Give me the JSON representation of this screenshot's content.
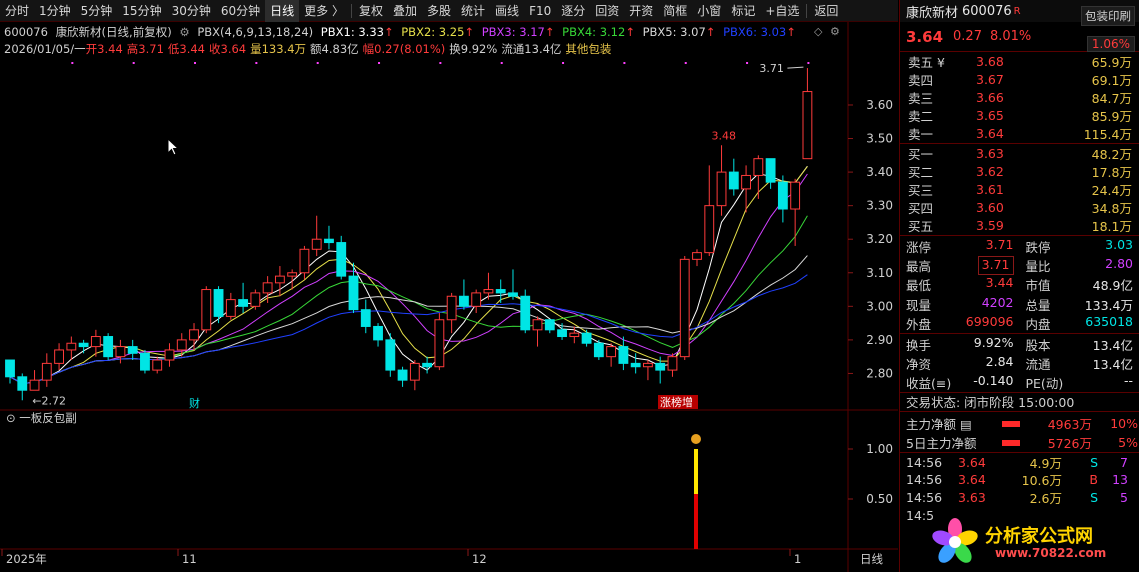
{
  "toolbar": {
    "items": [
      "分时",
      "1分钟",
      "5分钟",
      "15分钟",
      "30分钟",
      "60分钟",
      "日线",
      "更多 〉",
      "复权",
      "叠加",
      "多股",
      "统计",
      "画线",
      "F10",
      "逐分",
      "回资",
      "开资",
      "简框",
      "小窗",
      "标记",
      "+自选",
      "返回"
    ],
    "active_index": 6
  },
  "indicator_line": {
    "code": "600076",
    "name": "康欣新材(日线,前复权)",
    "formula": "PBX(4,6,9,13,18,24)",
    "pbx1": "PBX1: 3.33",
    "pbx2": "PBX2: 3.25",
    "pbx3": "PBX3: 3.17",
    "pbx4": "PBX4: 3.12",
    "pbx5": "PBX5: 3.07",
    "pbx6": "PBX6: 3.03"
  },
  "info_line": {
    "date": "2026/01/05/一",
    "open": "开3.44",
    "high": "高3.71",
    "low": "低3.44",
    "close": "收3.64",
    "volume": "量133.4万",
    "amount": "额4.83亿",
    "range": "幅0.27(8.01%)",
    "turnover": "换9.92%",
    "float": "流通13.4亿",
    "other": "其他包装"
  },
  "sub_indicator": {
    "title": "一板反包副"
  },
  "labels": {
    "high_label": "3.71",
    "peak_label": "3.48",
    "low_label": "2.72",
    "cai": "财",
    "zhangbang": "涨榜增"
  },
  "colors": {
    "up": "#ff3b3b",
    "down": "#00e5e5",
    "pbx1": "#ffffff",
    "pbx2": "#e6e04a",
    "pbx3": "#d040ff",
    "pbx4": "#38d838",
    "pbx5": "#d8d8d8",
    "pbx6": "#2040ff"
  },
  "chart_data": {
    "type": "candlestick",
    "price_axis": {
      "ticks": [
        "3.60",
        "3.50",
        "3.40",
        "3.30",
        "3.20",
        "3.10",
        "3.00",
        "2.90",
        "2.80"
      ],
      "min": 2.7,
      "max": 3.74
    },
    "sub_axis": {
      "ticks": [
        "1.00",
        "0.50"
      ]
    },
    "x_axis": {
      "labels": [
        "2025年",
        "11",
        "12",
        "1"
      ],
      "right_label": "日线"
    },
    "candles": [
      [
        2.84,
        2.84,
        2.77,
        2.79
      ],
      [
        2.79,
        2.8,
        2.72,
        2.75
      ],
      [
        2.75,
        2.81,
        2.75,
        2.78
      ],
      [
        2.78,
        2.86,
        2.76,
        2.83
      ],
      [
        2.83,
        2.89,
        2.81,
        2.87
      ],
      [
        2.87,
        2.91,
        2.84,
        2.89
      ],
      [
        2.89,
        2.9,
        2.86,
        2.88
      ],
      [
        2.88,
        2.93,
        2.85,
        2.91
      ],
      [
        2.91,
        2.92,
        2.84,
        2.85
      ],
      [
        2.85,
        2.9,
        2.83,
        2.88
      ],
      [
        2.88,
        2.9,
        2.84,
        2.86
      ],
      [
        2.86,
        2.87,
        2.8,
        2.81
      ],
      [
        2.81,
        2.85,
        2.8,
        2.84
      ],
      [
        2.84,
        2.89,
        2.82,
        2.87
      ],
      [
        2.87,
        2.92,
        2.85,
        2.9
      ],
      [
        2.9,
        2.95,
        2.87,
        2.93
      ],
      [
        2.93,
        3.06,
        2.92,
        3.05
      ],
      [
        3.05,
        3.06,
        2.95,
        2.97
      ],
      [
        2.97,
        3.04,
        2.96,
        3.02
      ],
      [
        3.02,
        3.07,
        2.98,
        3.0
      ],
      [
        3.0,
        3.05,
        2.99,
        3.04
      ],
      [
        3.04,
        3.09,
        3.01,
        3.07
      ],
      [
        3.07,
        3.12,
        3.03,
        3.09
      ],
      [
        3.09,
        3.11,
        3.05,
        3.1
      ],
      [
        3.1,
        3.18,
        3.08,
        3.17
      ],
      [
        3.17,
        3.27,
        3.15,
        3.2
      ],
      [
        3.2,
        3.24,
        3.17,
        3.19
      ],
      [
        3.19,
        3.21,
        3.08,
        3.09
      ],
      [
        3.09,
        3.13,
        2.98,
        2.99
      ],
      [
        2.99,
        3.02,
        2.92,
        2.94
      ],
      [
        2.94,
        2.95,
        2.88,
        2.9
      ],
      [
        2.9,
        2.92,
        2.79,
        2.81
      ],
      [
        2.81,
        2.82,
        2.76,
        2.78
      ],
      [
        2.78,
        2.84,
        2.75,
        2.83
      ],
      [
        2.83,
        2.85,
        2.8,
        2.82
      ],
      [
        2.82,
        2.98,
        2.81,
        2.96
      ],
      [
        2.96,
        3.04,
        2.92,
        3.03
      ],
      [
        3.03,
        3.08,
        2.99,
        3.0
      ],
      [
        3.0,
        3.05,
        2.98,
        3.04
      ],
      [
        3.04,
        3.1,
        3.02,
        3.05
      ],
      [
        3.05,
        3.08,
        3.01,
        3.04
      ],
      [
        3.04,
        3.11,
        3.02,
        3.03
      ],
      [
        3.03,
        3.05,
        2.92,
        2.93
      ],
      [
        2.93,
        2.97,
        2.88,
        2.96
      ],
      [
        2.96,
        2.96,
        2.92,
        2.93
      ],
      [
        2.93,
        2.95,
        2.9,
        2.91
      ],
      [
        2.91,
        2.94,
        2.89,
        2.92
      ],
      [
        2.92,
        2.93,
        2.88,
        2.89
      ],
      [
        2.89,
        2.9,
        2.84,
        2.85
      ],
      [
        2.85,
        2.89,
        2.82,
        2.88
      ],
      [
        2.88,
        2.91,
        2.81,
        2.83
      ],
      [
        2.83,
        2.86,
        2.8,
        2.82
      ],
      [
        2.82,
        2.84,
        2.78,
        2.83
      ],
      [
        2.83,
        2.85,
        2.77,
        2.81
      ],
      [
        2.81,
        2.86,
        2.79,
        2.85
      ],
      [
        2.85,
        3.15,
        2.84,
        3.14
      ],
      [
        3.14,
        3.17,
        3.12,
        3.16
      ],
      [
        3.16,
        3.42,
        3.15,
        3.3
      ],
      [
        3.3,
        3.48,
        3.27,
        3.4
      ],
      [
        3.4,
        3.44,
        3.33,
        3.35
      ],
      [
        3.35,
        3.42,
        3.28,
        3.39
      ],
      [
        3.39,
        3.45,
        3.32,
        3.44
      ],
      [
        3.44,
        3.44,
        3.35,
        3.37
      ],
      [
        3.37,
        3.39,
        3.25,
        3.29
      ],
      [
        3.29,
        3.38,
        3.18,
        3.37
      ],
      [
        3.44,
        3.71,
        3.44,
        3.64
      ]
    ],
    "signal_bar": {
      "yellow": 0.5,
      "red": 0.55,
      "total": 1.0
    }
  },
  "right_panel": {
    "name": "康欣新材",
    "code": "600076",
    "r": "R",
    "print_btn": "包装印刷",
    "price": "3.64",
    "change": "0.27",
    "pct": "8.01%",
    "pct_box": "1.06%",
    "asks": [
      {
        "label": "卖五 ¥",
        "price": "3.68",
        "vol": "65.9万"
      },
      {
        "label": "卖四",
        "price": "3.67",
        "vol": "69.1万"
      },
      {
        "label": "卖三",
        "price": "3.66",
        "vol": "84.7万"
      },
      {
        "label": "卖二",
        "price": "3.65",
        "vol": "85.9万"
      },
      {
        "label": "卖一",
        "price": "3.64",
        "vol": "115.4万"
      }
    ],
    "bids": [
      {
        "label": "买一",
        "price": "3.63",
        "vol": "48.2万"
      },
      {
        "label": "买二",
        "price": "3.62",
        "vol": "17.8万"
      },
      {
        "label": "买三",
        "price": "3.61",
        "vol": "24.4万"
      },
      {
        "label": "买四",
        "price": "3.60",
        "vol": "34.8万"
      },
      {
        "label": "买五",
        "price": "3.59",
        "vol": "18.1万"
      }
    ],
    "stats": [
      [
        {
          "k": "涨停",
          "v": "3.71",
          "c": "red"
        },
        {
          "k": "跌停",
          "v": "3.03",
          "c": "green"
        }
      ],
      [
        {
          "k": "最高",
          "v": "3.71",
          "c": "red boxed"
        },
        {
          "k": "量比",
          "v": "2.80",
          "c": "purple"
        }
      ],
      [
        {
          "k": "最低",
          "v": "3.44",
          "c": "red"
        },
        {
          "k": "市值",
          "v": "48.9亿",
          "c": "white"
        }
      ],
      [
        {
          "k": "现量",
          "v": "4202",
          "c": "purple"
        },
        {
          "k": "总量",
          "v": "133.4万",
          "c": "white"
        }
      ],
      [
        {
          "k": "外盘",
          "v": "699096",
          "c": "red"
        },
        {
          "k": "内盘",
          "v": "635018",
          "c": "green"
        }
      ]
    ],
    "stats2": [
      [
        {
          "k": "换手",
          "v": "9.92%",
          "c": "white"
        },
        {
          "k": "股本",
          "v": "13.4亿",
          "c": "white"
        }
      ],
      [
        {
          "k": "净资",
          "v": "2.84",
          "c": "white"
        },
        {
          "k": "流通",
          "v": "13.4亿",
          "c": "white"
        }
      ],
      [
        {
          "k": "收益(≡)",
          "v": "-0.140",
          "c": "white"
        },
        {
          "k": "PE(动)",
          "v": "--",
          "c": "white"
        }
      ]
    ],
    "trade_status": "交易状态: 闭市阶段 15:00:00",
    "flows": [
      {
        "k": "主力净额",
        "v": "4963万",
        "pct": "10%"
      },
      {
        "k": "5日主力净额",
        "v": "5726万",
        "pct": "5%"
      }
    ],
    "ticks": [
      {
        "t": "14:56",
        "p": "3.64",
        "v": "4.9万",
        "bs": "S",
        "bsc": "green",
        "n": "7"
      },
      {
        "t": "14:56",
        "p": "3.64",
        "v": "10.6万",
        "bs": "B",
        "bsc": "red",
        "n": "13"
      },
      {
        "t": "14:56",
        "p": "3.63",
        "v": "2.6万",
        "bs": "S",
        "bsc": "green",
        "n": "5"
      },
      {
        "t": "14:5",
        "p": "",
        "v": "",
        "bs": "",
        "bsc": "green",
        "n": ""
      }
    ],
    "logo_text": "分析家公式网",
    "logo_url": "www.70822.com"
  }
}
